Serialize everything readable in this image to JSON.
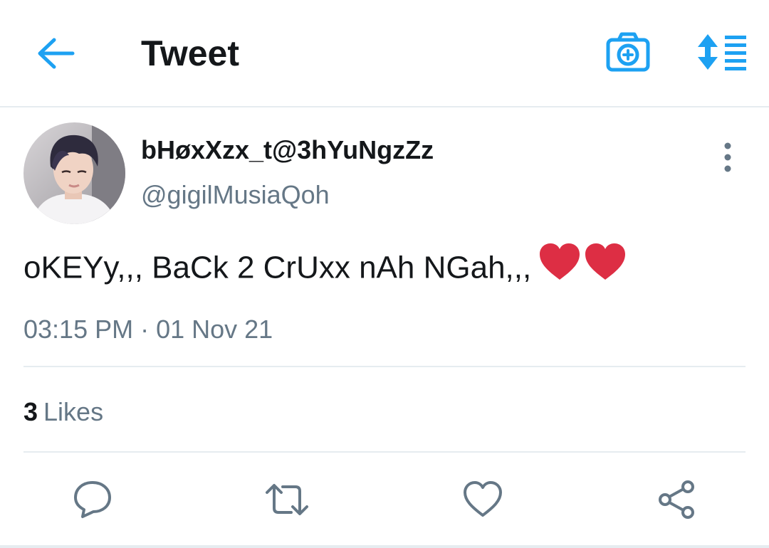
{
  "header": {
    "title": "Tweet",
    "back_icon": "arrow-left-icon",
    "camera_icon": "camera-add-icon",
    "sort_icon": "sort-list-icon"
  },
  "tweet": {
    "display_name": "bHøxXzx_t@3hYuNgzZz",
    "handle": "@gigilMusiaQoh",
    "text": "oKEYy,,, BaCk 2 CrUxx nAh NGah,,,",
    "emoji": "two red hearts",
    "timestamp": "03:15 PM · 01 Nov 21",
    "likes_count": "3",
    "likes_label": "Likes"
  },
  "actions": {
    "reply_icon": "reply-icon",
    "retweet_icon": "retweet-icon",
    "like_icon": "heart-icon",
    "share_icon": "share-icon"
  },
  "colors": {
    "accent": "#1da1f2",
    "text_primary": "#14171a",
    "text_secondary": "#657786",
    "divider": "#e6ecf0",
    "heart": "#e0245e"
  }
}
